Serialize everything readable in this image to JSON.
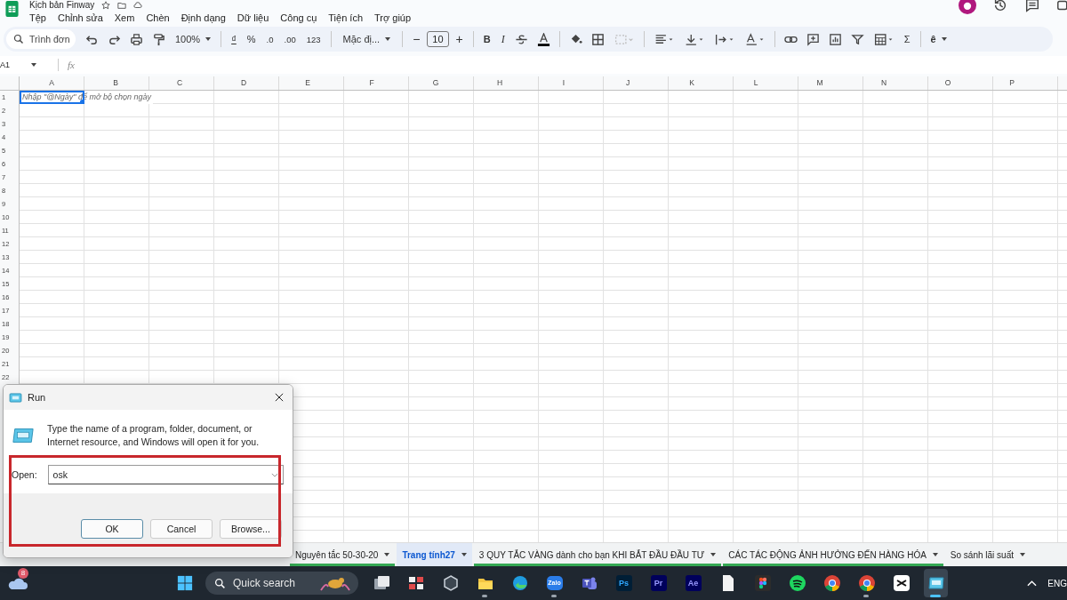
{
  "app": {
    "title": "Kịch bản Finway",
    "menu": [
      "Tệp",
      "Chỉnh sửa",
      "Xem",
      "Chèn",
      "Định dạng",
      "Dữ liệu",
      "Công cụ",
      "Tiện ích",
      "Trợ giúp"
    ]
  },
  "toolbar": {
    "search": "Trình đơn",
    "zoom": "100%",
    "currency": "₫",
    "percent": "%",
    "dec_less": ".0",
    "dec_more": ".00",
    "number_format": "123",
    "font": "Mặc đị...",
    "font_size": "10",
    "minus": "−",
    "plus": "+",
    "bold": "B",
    "italic": "I",
    "sum": "Σ",
    "input_tool": "ê"
  },
  "formula_bar": {
    "cell_ref": "A1",
    "fx": "fx"
  },
  "grid": {
    "columns": [
      "A",
      "B",
      "C",
      "D",
      "E",
      "F",
      "G",
      "H",
      "I",
      "J",
      "K",
      "L",
      "M",
      "N",
      "O",
      "P"
    ],
    "rows": [
      "1",
      "2",
      "3",
      "4",
      "5",
      "6",
      "7",
      "8",
      "9",
      "10",
      "11",
      "12",
      "13",
      "14",
      "15",
      "16",
      "17",
      "18",
      "19",
      "20",
      "21",
      "22"
    ],
    "active_cell_hint": "Nhập \"@Ngày\" để mở bộ chọn ngày"
  },
  "sheet_tabs": [
    {
      "label": "Nguyên tắc 50-30-20",
      "selected": false,
      "color": "#34a853"
    },
    {
      "label": "Trang tính27",
      "selected": true
    },
    {
      "label": "3 QUY TẮC VÀNG dành cho bạn KHI BẮT ĐẦU ĐẦU TƯ",
      "selected": false,
      "color": "#34a853"
    },
    {
      "label": "CÁC TÁC ĐỘNG ẢNH HƯỞNG ĐẾN HÀNG HÓA",
      "selected": false,
      "color": "#34a853"
    },
    {
      "label": "So sánh lãi suất",
      "selected": false
    }
  ],
  "run_dialog": {
    "title": "Run",
    "message": "Type the name of a program, folder, document, or Internet resource, and Windows will open it for you.",
    "open_label": "Open:",
    "value": "osk",
    "buttons": [
      {
        "label": "OK",
        "default": true
      },
      {
        "label": "Cancel",
        "default": false
      },
      {
        "label": "Browse...",
        "default": false
      }
    ]
  },
  "taskbar": {
    "weather_badge": "8",
    "search": "Quick search",
    "tray_language": "ENG",
    "apps": [
      {
        "kind": "taskview",
        "running": false,
        "selected": false
      },
      {
        "kind": "tiles",
        "running": false,
        "selected": false
      },
      {
        "kind": "prism",
        "running": false,
        "selected": false
      },
      {
        "kind": "folder",
        "running": true,
        "selected": false
      },
      {
        "kind": "edge",
        "running": false,
        "selected": false
      },
      {
        "kind": "zalo",
        "label": "Zalo",
        "running": true,
        "selected": false
      },
      {
        "kind": "teams",
        "running": false,
        "selected": false
      },
      {
        "kind": "ps",
        "label": "Ps",
        "running": false,
        "selected": false
      },
      {
        "kind": "pr",
        "label": "Pr",
        "running": false,
        "selected": false
      },
      {
        "kind": "ae",
        "label": "Ae",
        "running": false,
        "selected": false
      },
      {
        "kind": "document",
        "running": false,
        "selected": false
      },
      {
        "kind": "figma",
        "running": false,
        "selected": false
      },
      {
        "kind": "spotify",
        "running": false,
        "selected": false
      },
      {
        "kind": "chrome",
        "running": false,
        "selected": false
      },
      {
        "kind": "chrome",
        "running": true,
        "selected": false
      },
      {
        "kind": "capcut",
        "running": false,
        "selected": false
      },
      {
        "kind": "run",
        "running": true,
        "selected": true
      }
    ]
  }
}
